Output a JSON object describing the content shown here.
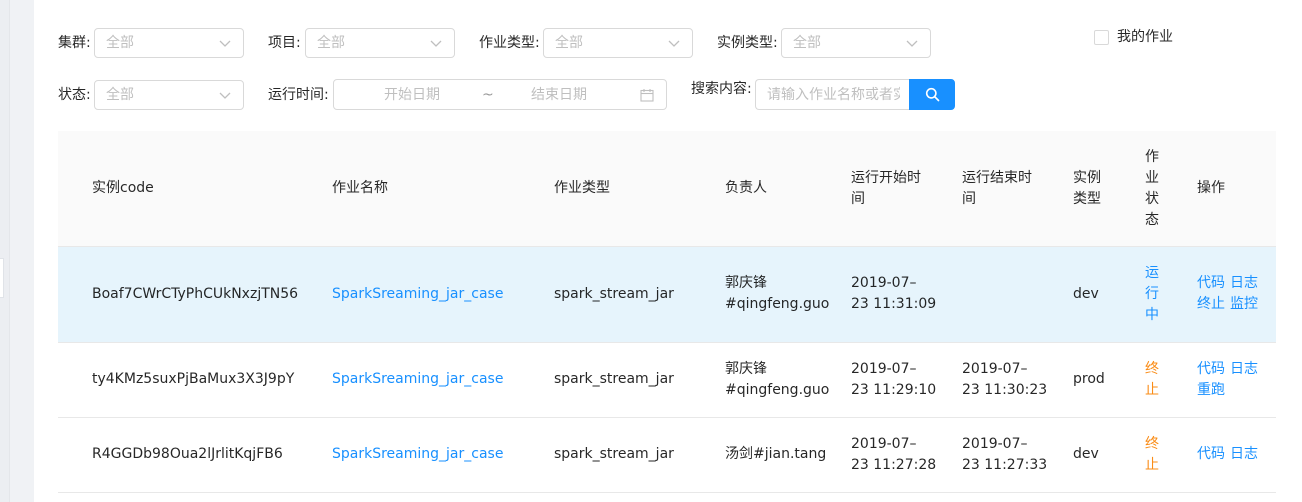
{
  "filters": {
    "cluster": {
      "label": "集群:",
      "value": "全部"
    },
    "project": {
      "label": "项目:",
      "value": "全部"
    },
    "job_type": {
      "label": "作业类型:",
      "value": "全部"
    },
    "instance_type": {
      "label": "实例类型:",
      "value": "全部"
    },
    "my_jobs_label": "我的作业",
    "status": {
      "label": "状态:",
      "value": "全部"
    },
    "run_time": {
      "label": "运行时间:",
      "start_placeholder": "开始日期",
      "separator": "~",
      "end_placeholder": "结束日期"
    },
    "search": {
      "label": "搜索内容:",
      "placeholder": "请输入作业名称或者实例code"
    }
  },
  "table": {
    "headers": {
      "code": "实例code",
      "name": "作业名称",
      "type": "作业类型",
      "owner": "负责人",
      "start_l1": "运行开始时",
      "start_l2": "间",
      "end_l1": "运行结束时",
      "end_l2": "间",
      "inst_l1": "实例",
      "inst_l2": "类型",
      "status_l1": "作",
      "status_l2": "业",
      "status_l3": "状",
      "status_l4": "态",
      "ops": "操作"
    },
    "rows": [
      {
        "code": "Boaf7CWrCTyPhCUkNxzjTN56",
        "name": "SparkSreaming_jar_case",
        "type": "spark_stream_jar",
        "owner_l1": "郭庆锋",
        "owner_l2": "#qingfeng.guo",
        "start_l1": "2019-07–",
        "start_l2": "23 11:31:09",
        "end_l1": "",
        "end_l2": "",
        "inst": "dev",
        "status_l1": "运",
        "status_l2": "行",
        "status_l3": "中",
        "op1": "代码",
        "op2": "日志",
        "op3": "终止",
        "op4": "监控"
      },
      {
        "code": "ty4KMz5suxPjBaMux3X3J9pY",
        "name": "SparkSreaming_jar_case",
        "type": "spark_stream_jar",
        "owner_l1": "郭庆锋",
        "owner_l2": "#qingfeng.guo",
        "start_l1": "2019-07–",
        "start_l2": "23 11:29:10",
        "end_l1": "2019-07–",
        "end_l2": "23 11:30:23",
        "inst": "prod",
        "status_l1": "终",
        "status_l2": "止",
        "op1": "代码",
        "op2": "日志",
        "op3": "重跑"
      },
      {
        "code": "R4GGDb98Oua2lJrlitKqjFB6",
        "name": "SparkSreaming_jar_case",
        "type": "spark_stream_jar",
        "owner": "汤剑#jian.tang",
        "start_l1": "2019-07–",
        "start_l2": "23 11:27:28",
        "end_l1": "2019-07–",
        "end_l2": "23 11:27:33",
        "inst": "dev",
        "status_l1": "终",
        "status_l2": "止",
        "op1": "代码",
        "op2": "日志"
      }
    ]
  },
  "colors": {
    "accent": "#1890ff",
    "stopped": "#fa8c16",
    "selected_row": "#e6f4fc"
  },
  "icons": {
    "dropdown": "chevron-down-icon",
    "calendar": "calendar-icon",
    "search": "search-icon"
  }
}
